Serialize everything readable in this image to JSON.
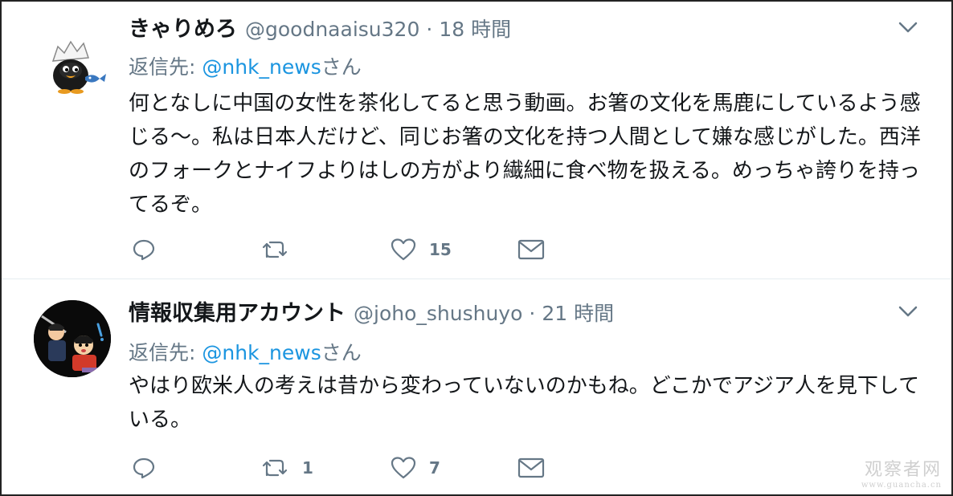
{
  "tweets": [
    {
      "display_name": "きゃりめろ",
      "handle": "@goodnaaisu320",
      "separator": "·",
      "time": "18 時間",
      "reply_prefix": "返信先: ",
      "reply_mention": "@nhk_news",
      "reply_suffix": "さん",
      "text": "何となしに中国の女性を茶化してると思う動画。お箸の文化を馬鹿にしているよう感じる〜。私は日本人だけど、同じお箸の文化を持つ人間として嫌な感じがした。西洋のフォークとナイフよりはしの方がより繊細に食べ物を扱える。めっちゃ誇りを持ってるぞ。",
      "reply_count": "",
      "retweet_count": "",
      "like_count": "15",
      "avatar_icon": "cartoon-chick-avatar"
    },
    {
      "display_name": "情報収集用アカウント",
      "handle": "@joho_shushuyo",
      "separator": "·",
      "time": "21 時間",
      "reply_prefix": "返信先: ",
      "reply_mention": "@nhk_news",
      "reply_suffix": "さん",
      "text": "やはり欧米人の考えは昔から変わっていないのかもね。どこかでアジア人を見下している。",
      "reply_count": "",
      "retweet_count": "1",
      "like_count": "7",
      "avatar_icon": "illustrated-people-avatar"
    }
  ],
  "icons": {
    "reply": "reply-icon",
    "retweet": "retweet-icon",
    "like": "heart-icon",
    "dm": "envelope-icon",
    "menu": "chevron-down-icon"
  },
  "colors": {
    "link": "#1b95e0",
    "secondary_text": "#657786",
    "primary_text": "#14171a",
    "divider": "#e6ecf0"
  },
  "watermark": {
    "main": "观察者网",
    "url": "www.guancha.cn"
  }
}
